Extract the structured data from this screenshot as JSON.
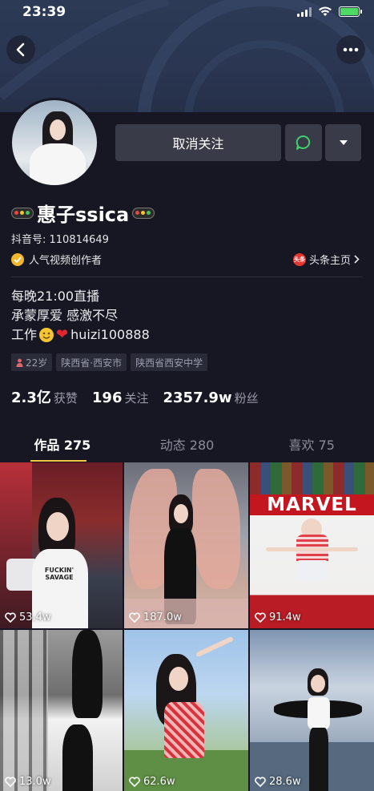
{
  "status_bar": {
    "time": "23:39"
  },
  "profile": {
    "name": "惠子ssica",
    "douyin_id": "抖音号: 110814649",
    "creator_label": "人气视频创作者",
    "toutiao_link": "头条主页",
    "toutiao_icon_text": "头条",
    "bio": {
      "line1": "每晚21:00直播",
      "line2": "承蒙厚爱 感激不尽",
      "line3_prefix": "工作",
      "line3_suffix": "huizi100888"
    },
    "tags": {
      "age": "22岁",
      "location": "陕西省·西安市",
      "school": "陕西省西安中学"
    },
    "stats": {
      "likes_value": "2.3亿",
      "likes_label": "获赞",
      "following_value": "196",
      "following_label": "关注",
      "followers_value": "2357.9w",
      "followers_label": "粉丝"
    }
  },
  "actions": {
    "unfollow_label": "取消关注"
  },
  "tabs": [
    {
      "label": "作品 275",
      "active": true
    },
    {
      "label": "动态 280",
      "active": false
    },
    {
      "label": "喜欢 75",
      "active": false
    }
  ],
  "videos": [
    {
      "likes": "53.4w",
      "shirt_text": "FUCKIN' SAVAGE"
    },
    {
      "likes": "187.0w"
    },
    {
      "likes": "91.4w",
      "banner_text": "MARVEL"
    },
    {
      "likes": "13.0w"
    },
    {
      "likes": "62.6w"
    },
    {
      "likes": "28.6w"
    }
  ],
  "colors": {
    "background": "#161722",
    "accent": "#f5c542",
    "button": "#3a3b48",
    "muted_text": "#9a9cab"
  },
  "icons": [
    "back-arrow-icon",
    "more-icon",
    "message-bubble-icon",
    "dropdown-triangle-icon",
    "verified-badge-icon",
    "heart-icon",
    "person-icon"
  ]
}
